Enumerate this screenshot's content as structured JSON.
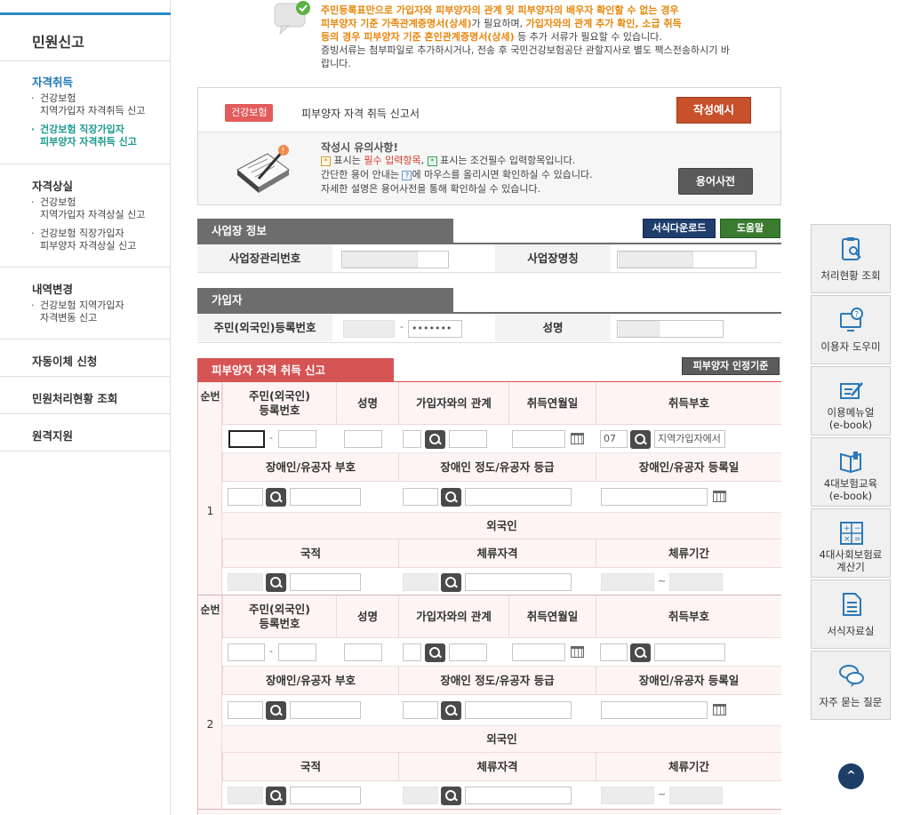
{
  "sidebar": {
    "title": "민원신고",
    "sections": [
      {
        "head": "자격취득",
        "items": [
          {
            "label1": "건강보험",
            "label2": "지역가입자 자격취득 신고",
            "active": false
          },
          {
            "label1": "건강보험 직장가입자",
            "label2": "피부양자 자격취득 신고",
            "active": true
          }
        ]
      },
      {
        "head": "자격상실",
        "items": [
          {
            "label1": "건강보험",
            "label2": "지역가입자 자격상실 신고",
            "active": false
          },
          {
            "label1": "건강보험 직장가입자",
            "label2": "피부양자 자격상실 신고",
            "active": false
          }
        ]
      },
      {
        "head": "내역변경",
        "items": [
          {
            "label1": "건강보험 지역가입자",
            "label2": "자격변동 신고",
            "active": false
          }
        ]
      },
      {
        "head": "자동이체 신청",
        "items": []
      },
      {
        "head": "민원처리현황 조회",
        "items": []
      },
      {
        "head": "원격지원",
        "items": []
      }
    ]
  },
  "notice": {
    "line1": "주민등록표만으로 가입자와 피부양자의 관계 및 피부양자의 배우자 확인할 수 없는 경우",
    "line2a": "피부양자 기준 가족관계증명서(상세)",
    "line2b": "가 필요하며, ",
    "line2c": "가입자와의 관계 추가 확인, 소급 취득",
    "line3a": "등의 경우 피부양자 기준 혼인관계증명서(상세)",
    "line3b": " 등 추가 서류가 필요할 수 있습니다.",
    "line4": "증빙서류는 첨부파일로 추가하시거나, 전송 후 국민건강보험공단 관할지사로 별도 팩스전송하시기 바",
    "line5": "랍니다."
  },
  "form_header": {
    "badge": "건강보험",
    "title": "피부양자 자격 취득 신고서",
    "example_btn": "작성예시",
    "notes_title": "작성시 유의사항!",
    "note1a": " 표시는 ",
    "note1b": "필수 입력항목",
    "note1c": ", ",
    "note1d": " 표시는 조건필수 입력항목입니다.",
    "note2a": "간단한 용어 안내는 ",
    "note2b": "에 마우스를 올리시면 확인하실 수 있습니다.",
    "note3": "자세한 설명은 용어사전을 통해 확인하실 수 있습니다.",
    "dict_btn": "용어사전"
  },
  "workplace": {
    "tab": "사업장 정보",
    "download_btn": "서식다운로드",
    "help_btn": "도움말",
    "mgmt_no_label": "사업장관리번호",
    "name_label": "사업장명칭"
  },
  "subscriber": {
    "tab": "가입자",
    "rrn_label": "주민(외국인)등록번호",
    "rrn_masked": "•••••••",
    "name_label": "성명"
  },
  "dependent": {
    "tab": "피부양자 자격 취득 신고",
    "criteria_btn": "피부양자 인정기준",
    "col_num": "순번",
    "col_rrn1": "주민(외국인)",
    "col_rrn2": "등록번호",
    "col_name": "성명",
    "col_relation": "가입자와의 관계",
    "col_date": "취득연월일",
    "col_code": "취득부호",
    "col_disabled": "장애인/유공자 부호",
    "col_grade": "장애인 정도/유공자 등급",
    "col_regdate": "장애인/유공자 등록일",
    "foreigner": "외국인",
    "col_nation": "국적",
    "col_stay": "체류자격",
    "col_period": "체류기간",
    "tilde": "~",
    "rows": [
      {
        "num": "1",
        "code_value": "07",
        "code_text": "지역가입자에서"
      },
      {
        "num": "2",
        "code_value": "",
        "code_text": ""
      }
    ]
  },
  "quick_menu": [
    {
      "l1": "처리현황 조회",
      "l2": "",
      "icon": "clipboard-search-icon"
    },
    {
      "l1": "이용자 도우미",
      "l2": "",
      "icon": "monitor-help-icon"
    },
    {
      "l1": "이용메뉴얼",
      "l2": "(e-book)",
      "icon": "pen-board-icon"
    },
    {
      "l1": "4대보험교육",
      "l2": "(e-book)",
      "icon": "book-icon"
    },
    {
      "l1": "4대사회보험료",
      "l2": "계산기",
      "icon": "calculator-icon"
    },
    {
      "l1": "서식자료실",
      "l2": "",
      "icon": "document-icon"
    },
    {
      "l1": "자주 묻는 질문",
      "l2": "",
      "icon": "chat-bubbles-icon"
    }
  ],
  "colors": {
    "accent_blue": "#2b8bc2",
    "red": "#d65454",
    "orange": "#e8860b"
  }
}
